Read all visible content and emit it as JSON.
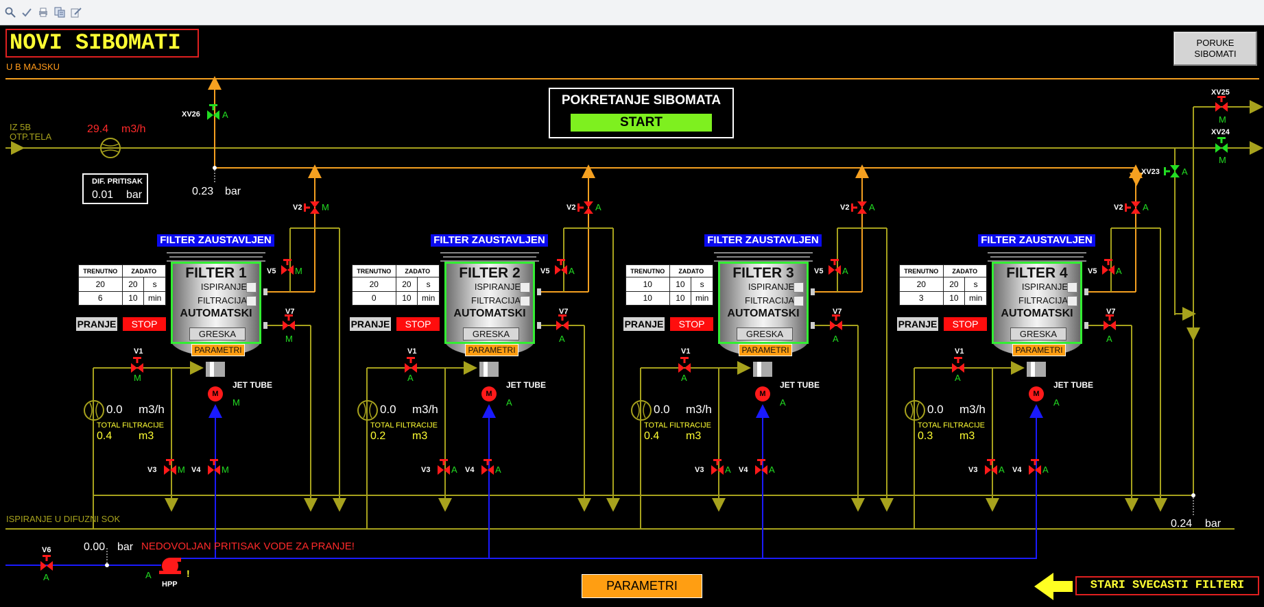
{
  "toolbar": {
    "icons": [
      "zoom-icon",
      "check-icon",
      "print-icon",
      "report-icon",
      "edit-icon"
    ]
  },
  "title": "NOVI SIBOMATI",
  "subtitle": "U B MAJSKU",
  "poruke_button": {
    "line1": "PORUKE",
    "line2": "SIBOMATI"
  },
  "start_panel": {
    "title": "POKRETANJE SIBOMATA",
    "button": "START"
  },
  "inlet": {
    "line1": "IZ 5B",
    "line2": "OTP.TELA",
    "flow_value": "29.4",
    "flow_unit": "m3/h"
  },
  "dif_pressure": {
    "label": "DIF. PRITISAK",
    "value": "0.01",
    "unit": "bar"
  },
  "pressure_top": {
    "value": "0.23",
    "unit": "bar"
  },
  "pressure_right": {
    "value": "0.24",
    "unit": "bar"
  },
  "pressure_water": {
    "value": "0.00",
    "unit": "bar"
  },
  "warning": "NEDOVOLJAN PRITISAK VODE ZA PRANJE!",
  "ispiranje_label": "ISPIRANJE U DIFUZNI SOK",
  "valves_main": {
    "xv26": {
      "label": "XV26",
      "mode": "A"
    },
    "xv25": {
      "label": "XV25",
      "mode": "M"
    },
    "xv24": {
      "label": "XV24",
      "mode": "M"
    },
    "xv23": {
      "label": "XV23",
      "mode": "A"
    },
    "v6": {
      "label": "V6",
      "mode": "A"
    }
  },
  "pump": {
    "label": "HPP",
    "mode": "A",
    "alarm": "!"
  },
  "table_headers": {
    "trenutno": "TRENUTNO",
    "zadato": "ZADATO",
    "unit1": "s",
    "unit2": "min"
  },
  "common": {
    "status": "FILTER ZAUSTAVLJEN",
    "ispiranje": "ISPIRANJE",
    "filtracija": "FILTRACIJA",
    "automatski": "AUTOMATSKI",
    "greska": "GRESKA",
    "parametri": "PARAMETRI",
    "pranje": "PRANJE",
    "stop": "STOP",
    "jet_tube": "JET TUBE",
    "motor": "M",
    "flow_unit": "m3/h",
    "total_label": "TOTAL FILTRACIJE",
    "total_unit": "m3",
    "v1": "V1",
    "v2": "V2",
    "v3": "V3",
    "v4": "V4",
    "v5": "V5",
    "v7": "V7"
  },
  "filters": [
    {
      "name": "FILTER 1",
      "t1": "20",
      "z1": "20",
      "t2": "6",
      "z2": "10",
      "flow": "0.0",
      "total": "0.4",
      "modes": {
        "v1": "M",
        "v2": "M",
        "v3": "M",
        "v4": "M",
        "v5": "M",
        "v7": "M",
        "motor": "M"
      }
    },
    {
      "name": "FILTER 2",
      "t1": "20",
      "z1": "20",
      "t2": "0",
      "z2": "10",
      "flow": "0.0",
      "total": "0.2",
      "modes": {
        "v1": "A",
        "v2": "A",
        "v3": "A",
        "v4": "A",
        "v5": "A",
        "v7": "A",
        "motor": "A"
      }
    },
    {
      "name": "FILTER 3",
      "t1": "10",
      "z1": "10",
      "t2": "10",
      "z2": "10",
      "flow": "0.0",
      "total": "0.4",
      "modes": {
        "v1": "A",
        "v2": "A",
        "v3": "A",
        "v4": "A",
        "v5": "A",
        "v7": "A",
        "motor": "A"
      }
    },
    {
      "name": "FILTER 4",
      "t1": "20",
      "z1": "20",
      "t2": "3",
      "z2": "10",
      "flow": "0.0",
      "total": "0.3",
      "modes": {
        "v1": "A",
        "v2": "A",
        "v3": "A",
        "v4": "A",
        "v5": "A",
        "v7": "A",
        "motor": "A"
      }
    }
  ],
  "bottom": {
    "parametri": "PARAMETRI",
    "stari": "STARI SVECASTI FILTERI"
  },
  "colors": {
    "orange_pipe": "#f5a020",
    "olive_pipe": "#a7a21d",
    "blue_pipe": "#1a1aff",
    "valve_red": "#ff1a1a",
    "valve_green": "#22dd22"
  }
}
